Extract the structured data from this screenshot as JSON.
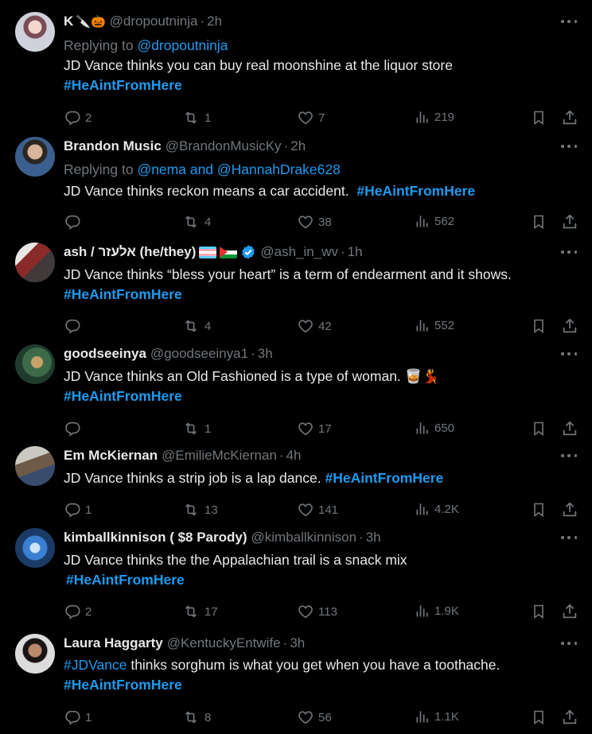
{
  "tweets": [
    {
      "name": "K",
      "name_suffix": "🔪🎃",
      "handle": "@dropoutninja",
      "time": "2h",
      "reply_prefix": "Replying to",
      "reply_to": "@dropoutninja",
      "text": "JD Vance thinks you can buy real moonshine at the liquor store",
      "hashtag": "#HeAintFromHere",
      "replies": "2",
      "retweets": "1",
      "likes": "7",
      "views": "219"
    },
    {
      "name": "Brandon Music",
      "handle": "@BrandonMusicKy",
      "time": "2h",
      "reply_prefix": "Replying to",
      "reply_to": "@nema and @HannahDrake628",
      "text": "JD Vance thinks reckon means a car accident.",
      "hashtag": "#HeAintFromHere",
      "replies": "",
      "retweets": "4",
      "likes": "38",
      "views": "562"
    },
    {
      "name": "ash / אלעזר (he/they)",
      "handle": "@ash_in_wv",
      "time": "1h",
      "text": "JD Vance thinks “bless your heart” is a term of endearment and it shows.",
      "hashtag": "#HeAintFromHere",
      "replies": "",
      "retweets": "4",
      "likes": "42",
      "views": "552"
    },
    {
      "name": "goodseeinya",
      "handle": "@goodseeinya1",
      "time": "3h",
      "text": "JD Vance thinks an Old Fashioned is a type of woman.",
      "text_emoji": "🥃💃",
      "hashtag": "#HeAintFromHere",
      "replies": "",
      "retweets": "1",
      "likes": "17",
      "views": "650"
    },
    {
      "name": "Em McKiernan",
      "handle": "@EmilieMcKiernan",
      "time": "4h",
      "text": "JD Vance thinks a strip job is a lap dance.",
      "hashtag": "#HeAintFromHere",
      "replies": "1",
      "retweets": "13",
      "likes": "141",
      "views": "4.2K"
    },
    {
      "name": "kimballkinnison ( $8 Parody)",
      "handle": "@kimballkinnison",
      "time": "3h",
      "text": "JD Vance thinks the the Appalachian trail is a snack mix",
      "hashtag": "#HeAintFromHere",
      "replies": "2",
      "retweets": "17",
      "likes": "113",
      "views": "1.9K"
    },
    {
      "name": "Laura Haggarty",
      "handle": "@KentuckyEntwife",
      "time": "3h",
      "text_link": "#JDVance",
      "text": "thinks sorghum is what you get when you have a toothache.",
      "hashtag": "#HeAintFromHere",
      "replies": "1",
      "retweets": "8",
      "likes": "56",
      "views": "1.1K"
    }
  ],
  "separator": "·",
  "colors": {
    "background": "#000000",
    "text": "#e7e9ea",
    "muted": "#71767b",
    "link": "#1d9bf0",
    "verified": "#1d9bf0"
  },
  "icons": [
    "reply-icon",
    "retweet-icon",
    "like-icon",
    "views-icon",
    "bookmark-icon",
    "share-icon",
    "more-icon",
    "verified-badge-icon"
  ]
}
